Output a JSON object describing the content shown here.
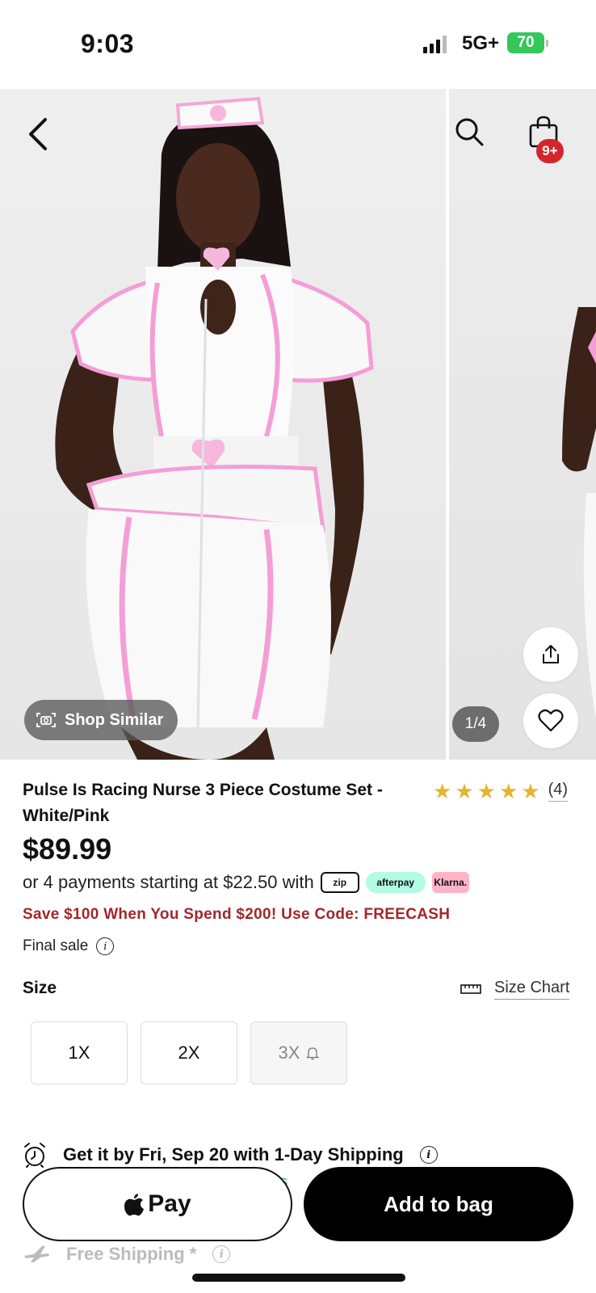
{
  "status_bar": {
    "time": "9:03",
    "network": "5G+",
    "battery": "70"
  },
  "gallery": {
    "pager": "1/4",
    "shop_similar": "Shop Similar",
    "bag_badge": "9+"
  },
  "product": {
    "title": "Pulse Is Racing Nurse 3 Piece Costume Set - White/Pink",
    "rating_count": "(4)",
    "rating_stars": 5,
    "price": "$89.99",
    "installments": "or 4 payments starting at $22.50 with",
    "pay_badges": {
      "zip": "zip",
      "afterpay": "afterpay",
      "klarna": "Klarna."
    },
    "promo": "Save $100 When You Spend $200! Use Code: FREECASH",
    "final_sale": "Final sale"
  },
  "size": {
    "label": "Size",
    "chart_label": "Size Chart",
    "options": [
      "1X",
      "2X",
      "3X"
    ]
  },
  "delivery": {
    "text": "Get it by Fri, Sep 20 with 1-Day Shipping",
    "free_shipping": "Free Shipping *",
    "partial_green": "s"
  },
  "actions": {
    "applepay": "Pay",
    "add_to_bag": "Add to bag"
  },
  "colors": {
    "promo_red": "#a3262a",
    "badge_red": "#d3262c",
    "star_gold": "#e8b32f",
    "battery_green": "#34c759"
  }
}
